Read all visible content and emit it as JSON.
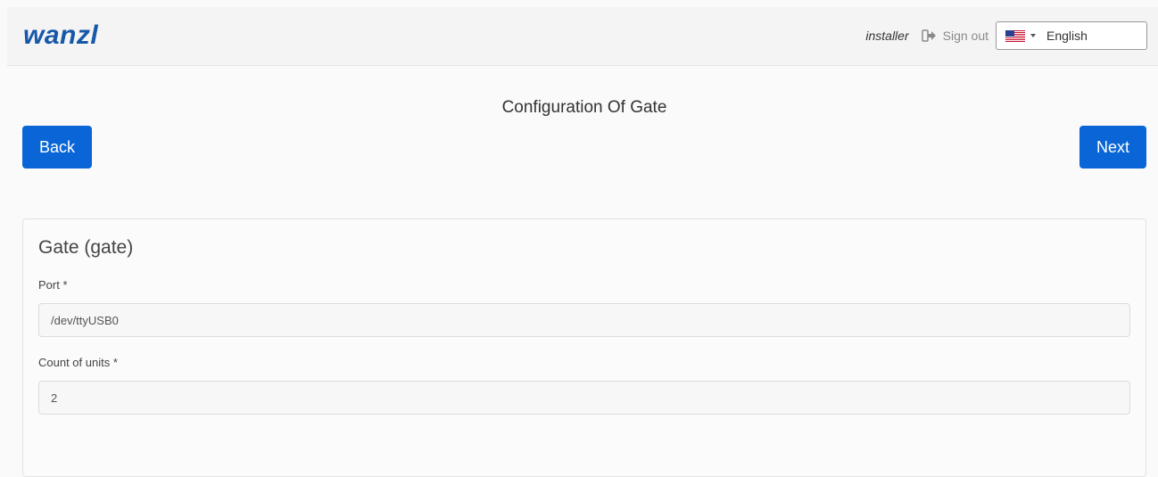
{
  "header": {
    "logo_text": "wanzl",
    "username": "installer",
    "signout_label": "Sign out",
    "language": {
      "selected": "English",
      "flag": "us-flag-icon"
    }
  },
  "page": {
    "title": "Configuration Of Gate",
    "back_label": "Back",
    "next_label": "Next"
  },
  "panel": {
    "title": "Gate (gate)",
    "fields": [
      {
        "label": "Port *",
        "value": "/dev/ttyUSB0"
      },
      {
        "label": "Count of units *",
        "value": "2"
      }
    ]
  },
  "colors": {
    "brand": "#1758a8",
    "primary_button": "#0a66d6"
  }
}
